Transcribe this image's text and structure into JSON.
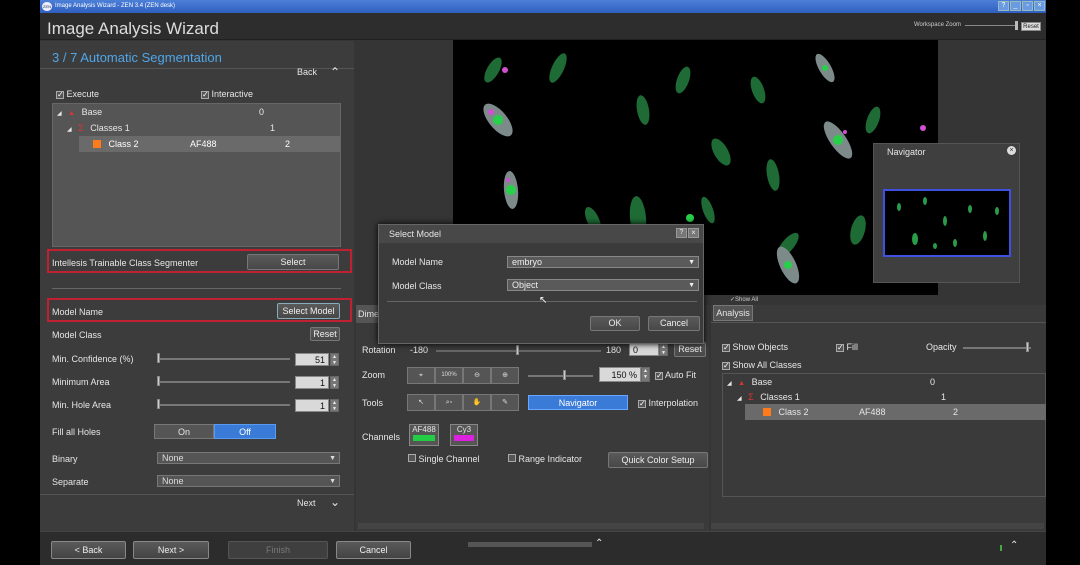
{
  "window": {
    "title": "Image Analysis Wizard - ZEN 3.4 (ZEN desk)",
    "logo": "ZEN"
  },
  "header": {
    "title": "Image Analysis Wizard",
    "workspace_zoom": "Workspace Zoom",
    "reset": "Reset"
  },
  "left": {
    "step": "3 / 7 Automatic Segmentation",
    "back": "Back",
    "execute": "Execute",
    "interactive": "Interactive",
    "tree": [
      {
        "name": "Base",
        "value": "0"
      },
      {
        "name": "Classes 1",
        "value": "1"
      },
      {
        "name": "Class 2",
        "channel": "AF488",
        "value": "2"
      }
    ],
    "segmenter": "Intellesis Trainable Class Segmenter",
    "select": "Select",
    "model_name": "Model Name",
    "select_model": "Select Model",
    "model_class": "Model Class",
    "reset": "Reset",
    "min_conf": "Min. Confidence (%)",
    "min_conf_val": "51",
    "min_area": "Minimum Area",
    "min_area_val": "1",
    "min_hole": "Min. Hole Area",
    "min_hole_val": "1",
    "fill_holes": "Fill all Holes",
    "on": "On",
    "off": "Off",
    "binary": "Binary",
    "binary_val": "None",
    "separate": "Separate",
    "separate_val": "None",
    "next": "Next"
  },
  "bottom": {
    "back": "< Back",
    "next": "Next >",
    "finish": "Finish",
    "cancel": "Cancel"
  },
  "navigator": {
    "title": "Navigator"
  },
  "dialog": {
    "title": "Select Model",
    "model_name_label": "Model Name",
    "model_name_val": "embryo",
    "model_class_label": "Model Class",
    "model_class_val": "Object",
    "ok": "OK",
    "cancel": "Cancel",
    "help": "?",
    "close": "×"
  },
  "tools": {
    "tab": "Dime",
    "rotation": "Rotation",
    "rot_min": "-180",
    "rot_max": "180",
    "rot_val": "0",
    "reset": "Reset",
    "zoom": "Zoom",
    "zoom_100": "100%",
    "zoom_val": "150 %",
    "auto_fit": "Auto Fit",
    "tools_label": "Tools",
    "navigator": "Navigator",
    "interpolation": "Interpolation",
    "channels": "Channels",
    "ch1": "AF488",
    "ch2": "Cy3",
    "single_channel": "Single Channel",
    "range_indicator": "Range Indicator",
    "quick_color": "Quick Color Setup"
  },
  "analysis": {
    "tab": "Analysis",
    "show_all": "Show All",
    "show_objects": "Show Objects",
    "fill": "Fill",
    "opacity": "Opacity",
    "show_all_classes": "Show All Classes",
    "tree": [
      {
        "name": "Base",
        "value": "0"
      },
      {
        "name": "Classes 1",
        "value": "1"
      },
      {
        "name": "Class 2",
        "channel": "AF488",
        "value": "2"
      }
    ]
  },
  "colors": {
    "accent": "#4fa6e8",
    "highlight": "#c02030",
    "af488": "#22cc44",
    "cy3": "#dd22dd",
    "class_orange": "#ff7a1a"
  }
}
